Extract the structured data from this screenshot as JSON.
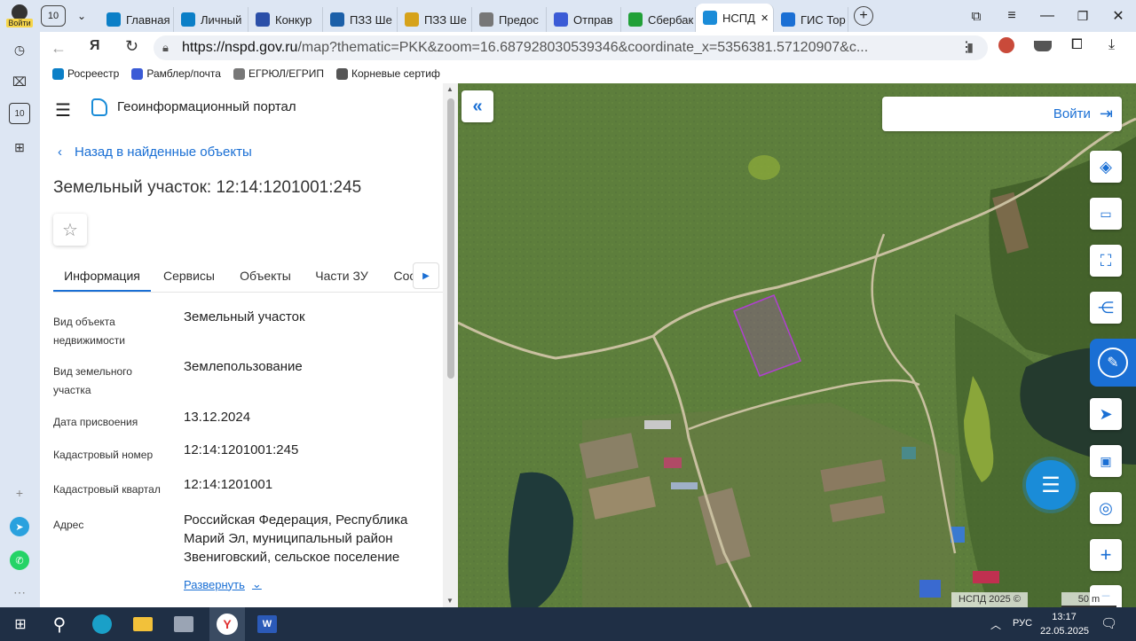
{
  "browser": {
    "tab_count": "10",
    "tabs": [
      {
        "label": "Главная",
        "icon": "rosreestr-icon",
        "color": "#0b7fc7"
      },
      {
        "label": "Личный",
        "icon": "rosreestr-icon",
        "color": "#0b7fc7"
      },
      {
        "label": "Конкур",
        "icon": "emblem-icon",
        "color": "#2b4fa8"
      },
      {
        "label": "ПЗЗ Ше",
        "icon": "wave-icon",
        "color": "#1b5fa8"
      },
      {
        "label": "ПЗЗ Ше",
        "icon": "document-icon",
        "color": "#d6a21a"
      },
      {
        "label": "Предос",
        "icon": "seal-icon",
        "color": "#777777"
      },
      {
        "label": "Отправ",
        "icon": "mail-icon",
        "color": "#3b5bd6"
      },
      {
        "label": "Сбербак",
        "icon": "sber-icon",
        "color": "#21a038"
      },
      {
        "label": "НСПД",
        "icon": "nspd-icon",
        "color": "#1a8cd8"
      },
      {
        "label": "ГИС Тор",
        "icon": "gis-icon",
        "color": "#1a6fd4"
      }
    ],
    "active_tab_index": 8,
    "login_label": "Войти",
    "url_host": "https://nspd.gov.ru",
    "url_rest": "/map?thematic=PKK&zoom=16.687928030539346&coordinate_x=5356381.57120907&c...",
    "bookmarks": [
      {
        "label": "Росреестр",
        "icon": "rosreestr-icon"
      },
      {
        "label": "Рамблер/почта",
        "icon": "mail-icon"
      },
      {
        "label": "ЕГРЮЛ/ЕГРИП",
        "icon": "seal-icon"
      },
      {
        "label": "Корневые сертиф",
        "icon": "emblem-icon"
      }
    ]
  },
  "portal": {
    "name": "Геоинформационный портал",
    "back_link": "Назад в найденные объекты",
    "title": "Земельный участок: 12:14:1201001:245",
    "tabs": [
      "Информация",
      "Сервисы",
      "Объекты",
      "Части ЗУ",
      "Соста"
    ],
    "active_tab": 0,
    "fields": [
      {
        "label": [
          "Вид объекта",
          "недвижимости"
        ],
        "value": [
          "Земельный участок"
        ]
      },
      {
        "label": [
          "Вид земельного",
          "участка"
        ],
        "value": [
          "Землепользование"
        ]
      },
      {
        "label": [
          "Дата присвоения"
        ],
        "value": [
          "13.12.2024"
        ]
      },
      {
        "label": [
          "Кадастровый номер"
        ],
        "value": [
          "12:14:1201001:245"
        ]
      },
      {
        "label": [
          "Кадастровый квартал"
        ],
        "value": [
          "12:14:1201001"
        ]
      },
      {
        "label": [
          "Адрес"
        ],
        "value": [
          "Российская Федерация, Республика",
          "Марий Эл, муниципальный район",
          "Звениговский, сельское поселение"
        ]
      }
    ],
    "expand_label": "Развернуть"
  },
  "map": {
    "login_label": "Войти",
    "copyright": "НСПД 2025 ©",
    "scale_label": "50 m",
    "accent": "#1a6fd4",
    "parcel_color": "#b040d0",
    "tools": [
      "layers-icon",
      "ruler-icon",
      "select-area-icon",
      "share-icon",
      "draw-icon",
      "locate-icon",
      "print-icon",
      "search-location-icon",
      "zoom-in-icon"
    ]
  },
  "taskbar": {
    "language": "РУС",
    "time": "13:17",
    "date": "22.05.2025"
  }
}
